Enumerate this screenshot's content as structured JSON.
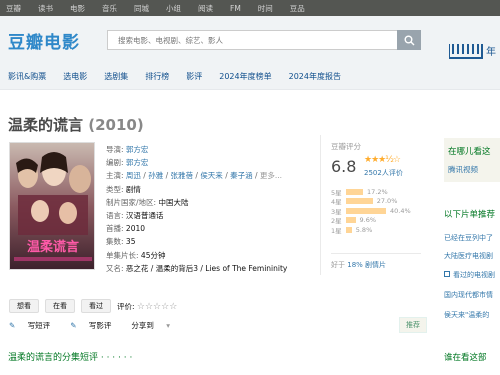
{
  "topbar": {
    "items": [
      "豆瓣",
      "读书",
      "电影",
      "音乐",
      "同城",
      "小组",
      "阅读",
      "FM",
      "时间",
      "豆品"
    ]
  },
  "header": {
    "logo": "豆瓣电影",
    "search_placeholder": "搜索电影、电视剧、综艺、影人",
    "promo_text": "2",
    "promo_text2": "年"
  },
  "nav": {
    "items": [
      "影讯&购票",
      "选电影",
      "选剧集",
      "排行榜",
      "影评",
      "2024年度榜单",
      "2024年度报告"
    ]
  },
  "subject": {
    "title": "温柔的谎言",
    "year": "(2010)",
    "director_label": "导演:",
    "director": "郭方宏",
    "writer_label": "编剧:",
    "writer": "郭方宏",
    "cast_label": "主演:",
    "cast": [
      "周迅",
      "孙雅",
      "张雅蓓",
      "侯天来",
      "秦子涵"
    ],
    "cast_more": "更多...",
    "genre_label": "类型:",
    "genre": "剧情",
    "country_label": "制片国家/地区:",
    "country": "中国大陆",
    "language_label": "语言:",
    "language": "汉语普通话",
    "premiere_label": "首播:",
    "premiere": "2010",
    "episodes_label": "集数:",
    "episodes": "35",
    "runtime_label": "单集片长:",
    "runtime": "45分钟",
    "aka_label": "又名:",
    "aka": "恶之花 / 温柔的背后3 / Lies of The Femininity"
  },
  "rating": {
    "label": "豆瓣评分",
    "score": "6.8",
    "stars": "★★★½☆",
    "count": "2502人评价",
    "breakdown": [
      {
        "star": "5星",
        "pct": "17.2%",
        "value": 17.2
      },
      {
        "star": "4星",
        "pct": "27.0%",
        "value": 27.0
      },
      {
        "star": "3星",
        "pct": "40.4%",
        "value": 40.4
      },
      {
        "star": "2星",
        "pct": "9.6%",
        "value": 9.6
      },
      {
        "star": "1星",
        "pct": "5.8%",
        "value": 5.8
      }
    ],
    "better_prefix": "好于 ",
    "better_pct": "18%",
    "better_suffix": " 剧情片"
  },
  "actions": {
    "want": "想看",
    "watching": "在看",
    "watched": "看过",
    "my_rating": "评价:",
    "empty_stars": "☆☆☆☆☆",
    "write_short": "写短评",
    "write_review": "写影评",
    "share": "分享到",
    "share_arrow": "▾",
    "recommend": "推荐"
  },
  "episodes_heading": "温柔的谎言的分集短评 · · · · · ·",
  "side": {
    "where_title": "在哪儿看这",
    "where_source": "腾讯视频",
    "playlist_title": "以下片单推荐",
    "lists": [
      "已经在豆列中了",
      "大陆医疗电视剧",
      "看过的电视剧",
      "国内现代都市情",
      "侯天来\"温柔的"
    ],
    "who_title": "谁在看这部"
  }
}
